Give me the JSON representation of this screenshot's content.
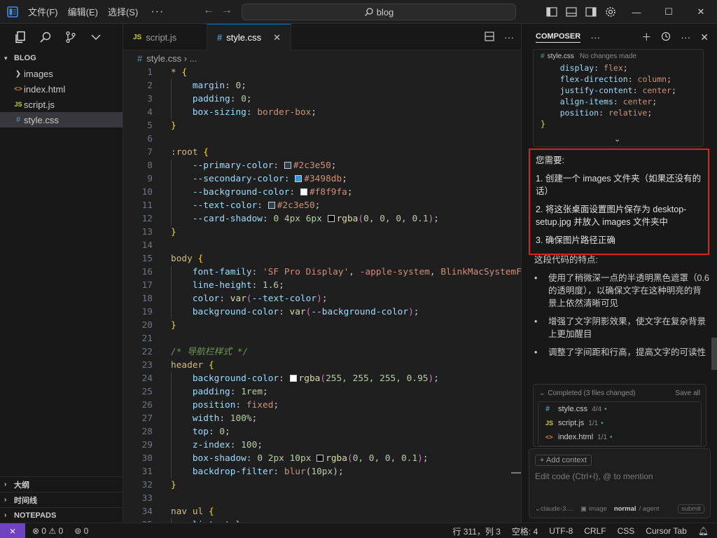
{
  "titlebar": {
    "menu": [
      "文件(F)",
      "编辑(E)",
      "选择(S)"
    ],
    "more": "···",
    "search_text": "blog"
  },
  "sidebar": {
    "root_label": "BLOG",
    "items": [
      {
        "label": "images",
        "icon": "folder-chevron-icon"
      },
      {
        "label": "index.html",
        "icon": "html-file-icon"
      },
      {
        "label": "script.js",
        "icon": "js-file-icon"
      },
      {
        "label": "style.css",
        "icon": "css-file-icon"
      }
    ],
    "sections": [
      "大纲",
      "时间线",
      "NOTEPADS"
    ]
  },
  "editor": {
    "tabs": [
      {
        "label": "script.js",
        "icon": "JS"
      },
      {
        "label": "style.css",
        "icon": "#"
      }
    ],
    "breadcrumb": {
      "file": "style.css",
      "rest": "..."
    }
  },
  "code_lines": [
    "* {",
    "    margin: 0;",
    "    padding: 0;",
    "    box-sizing: border-box;",
    "}",
    "",
    ":root {",
    "    --primary-color: #2c3e50;",
    "    --secondary-color: #3498db;",
    "    --background-color: #f8f9fa;",
    "    --text-color: #2c3e50;",
    "    --card-shadow: 0 4px 6px rgba(0, 0, 0, 0.1);",
    "}",
    "",
    "body {",
    "    font-family: 'SF Pro Display', -apple-system, BlinkMacSystemF",
    "    line-height: 1.6;",
    "    color: var(--text-color);",
    "    background-color: var(--background-color);",
    "}",
    "",
    "/* 导航栏样式 */",
    "header {",
    "    background-color: rgba(255, 255, 255, 0.95);",
    "    padding: 1rem;",
    "    position: fixed;",
    "    width: 100%;",
    "    top: 0;",
    "    z-index: 100;",
    "    box-shadow: 0 2px 10px rgba(0, 0, 0, 0.1);",
    "    backdrop-filter: blur(10px);",
    "}",
    "",
    "nav ul {",
    "    list-style: none;"
  ],
  "swatch_colors": {
    "primary": "#2c3e50",
    "secondary": "#3498db",
    "background": "#f8f9fa",
    "white": "#ffffff",
    "black": "#000000"
  },
  "composer": {
    "title": "COMPOSER",
    "diff_file": "style.css",
    "diff_status": "No changes made",
    "diff_lines": [
      "    display: flex;",
      "    flex-direction: column;",
      "    justify-content: center;",
      "    align-items: center;",
      "    position: relative;",
      "}"
    ],
    "note_title": "您需要:",
    "note_items": [
      "1. 创建一个 images 文件夹（如果还没有的话）",
      "2. 将这张桌面设置图片保存为 desktop-setup.jpg 并放入 images 文件夹中",
      "3. 确保图片路径正确"
    ],
    "features_intro": "这段代码的特点:",
    "features": [
      "使用了稍微深一点的半透明黑色遮罩（0.6的透明度），以确保文字在这种明亮的背景上依然清晰可见",
      "增强了文字阴影效果，使文字在复杂背景上更加醒目",
      "调整了字间距和行高，提高文字的可读性"
    ],
    "completed_label": "Completed (3 files changed)",
    "save_all": "Save all",
    "files": [
      {
        "name": "style.css",
        "count": "4/4",
        "icon": "#"
      },
      {
        "name": "script.js",
        "count": "1/1",
        "icon": "JS"
      },
      {
        "name": "index.html",
        "count": "1/1",
        "icon": "<>"
      }
    ],
    "add_context": "+ Add context",
    "input_placeholder": "Edit code (Ctrl+I), @ to mention",
    "model": "⌄claude-3....",
    "image_label": "image",
    "mode_normal": "normal",
    "mode_agent": "/ agent",
    "submit": "submit"
  },
  "statusbar": {
    "problems": "0",
    "warnings": "0",
    "ports": "0",
    "position": "行 311，列 3",
    "spaces": "空格: 4",
    "encoding": "UTF-8",
    "eol": "CRLF",
    "language": "CSS",
    "cursor_tab": "Cursor Tab"
  }
}
